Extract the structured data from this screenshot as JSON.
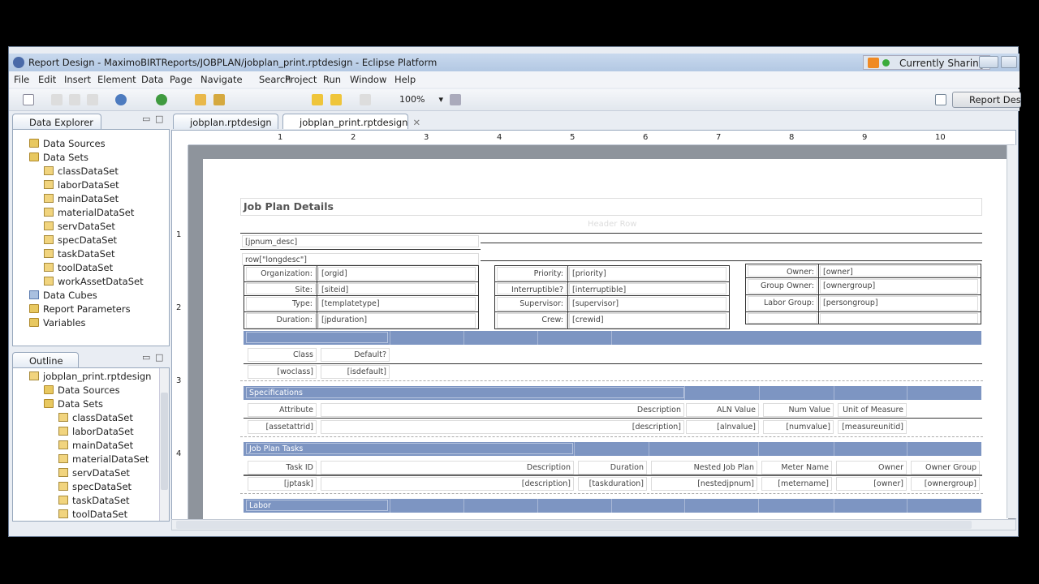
{
  "window": {
    "title": "Report Design - MaximoBIRTReports/JOBPLAN/jobplan_print.rptdesign - Eclipse Platform",
    "sharing": "Currently Sharing"
  },
  "menu": [
    "File",
    "Edit",
    "Insert",
    "Element",
    "Data",
    "Page",
    "Navigate",
    "Search",
    "Project",
    "Run",
    "Window",
    "Help"
  ],
  "toolbar": {
    "zoom": "100%",
    "perspective": "Report Design"
  },
  "data_explorer": {
    "title": "Data Explorer",
    "items": [
      {
        "label": "Data Sources",
        "level": 0,
        "icon": "folder"
      },
      {
        "label": "Data Sets",
        "level": 0,
        "icon": "folder"
      },
      {
        "label": "classDataSet",
        "level": 1,
        "icon": "dataset"
      },
      {
        "label": "laborDataSet",
        "level": 1,
        "icon": "dataset"
      },
      {
        "label": "mainDataSet",
        "level": 1,
        "icon": "dataset"
      },
      {
        "label": "materialDataSet",
        "level": 1,
        "icon": "dataset"
      },
      {
        "label": "servDataSet",
        "level": 1,
        "icon": "dataset"
      },
      {
        "label": "specDataSet",
        "level": 1,
        "icon": "dataset"
      },
      {
        "label": "taskDataSet",
        "level": 1,
        "icon": "dataset"
      },
      {
        "label": "toolDataSet",
        "level": 1,
        "icon": "dataset"
      },
      {
        "label": "workAssetDataSet",
        "level": 1,
        "icon": "dataset"
      },
      {
        "label": "Data Cubes",
        "level": 0,
        "icon": "cube"
      },
      {
        "label": "Report Parameters",
        "level": 0,
        "icon": "folder"
      },
      {
        "label": "Variables",
        "level": 0,
        "icon": "folder"
      }
    ]
  },
  "outline": {
    "title": "Outline",
    "items": [
      {
        "label": "jobplan_print.rptdesign",
        "level": 0,
        "icon": "report"
      },
      {
        "label": "Data Sources",
        "level": 1,
        "icon": "folder"
      },
      {
        "label": "Data Sets",
        "level": 1,
        "icon": "folder"
      },
      {
        "label": "classDataSet",
        "level": 2,
        "icon": "dataset"
      },
      {
        "label": "laborDataSet",
        "level": 2,
        "icon": "dataset"
      },
      {
        "label": "mainDataSet",
        "level": 2,
        "icon": "dataset"
      },
      {
        "label": "materialDataSet",
        "level": 2,
        "icon": "dataset"
      },
      {
        "label": "servDataSet",
        "level": 2,
        "icon": "dataset"
      },
      {
        "label": "specDataSet",
        "level": 2,
        "icon": "dataset"
      },
      {
        "label": "taskDataSet",
        "level": 2,
        "icon": "dataset"
      },
      {
        "label": "toolDataSet",
        "level": 2,
        "icon": "dataset"
      }
    ]
  },
  "editor_tabs": [
    "jobplan.rptdesign",
    "jobplan_print.rptdesign"
  ],
  "ruler": [
    "1",
    "2",
    "3",
    "4",
    "5",
    "6",
    "7",
    "8",
    "9",
    "10"
  ],
  "vruler": [
    "1",
    "2",
    "3",
    "4"
  ],
  "report": {
    "title": "Job Plan Details",
    "header_row": "Header Row",
    "jpnum_desc": "[jpnum_desc]",
    "longdesc": "row[\"longdesc\"]",
    "left_grid": [
      [
        "Organization:",
        "[orgid]"
      ],
      [
        "Site:",
        "[siteid]"
      ],
      [
        "Type:",
        "[templatetype]"
      ],
      [
        "Duration:",
        "[jpduration]"
      ]
    ],
    "mid_grid": [
      [
        "Priority:",
        "[priority]"
      ],
      [
        "Interruptible?",
        "[interruptible]"
      ],
      [
        "Supervisor:",
        "[supervisor]"
      ],
      [
        "Crew:",
        "[crewid]"
      ]
    ],
    "right_grid": [
      [
        "Owner:",
        "[owner]"
      ],
      [
        "Group Owner:",
        "[ownergroup]"
      ],
      [
        "Labor Group:",
        "[persongroup]"
      ],
      [
        "",
        ""
      ]
    ],
    "class_headers": [
      "Class",
      "Default?"
    ],
    "class_values": [
      "[woclass]",
      "[isdefault]"
    ],
    "spec_title": "Specifications",
    "spec_headers": [
      "Attribute",
      "Description",
      "ALN Value",
      "Num Value",
      "Unit of Measure"
    ],
    "spec_values": [
      "[assetattrid]",
      "[description]",
      "[alnvalue]",
      "[numvalue]",
      "[measureunitid]"
    ],
    "task_title": "Job Plan Tasks",
    "task_headers": [
      "Task ID",
      "Description",
      "Duration",
      "Nested Job Plan",
      "Meter Name",
      "Owner",
      "Owner Group"
    ],
    "task_values": [
      "[jptask]",
      "[description]",
      "[taskduration]",
      "[nestedjpnum]",
      "[metername]",
      "[owner]",
      "[ownergroup]"
    ],
    "labor_title": "Labor"
  },
  "colors": {
    "band": "#7d95c2",
    "titlebar": "#b3c8e3"
  }
}
